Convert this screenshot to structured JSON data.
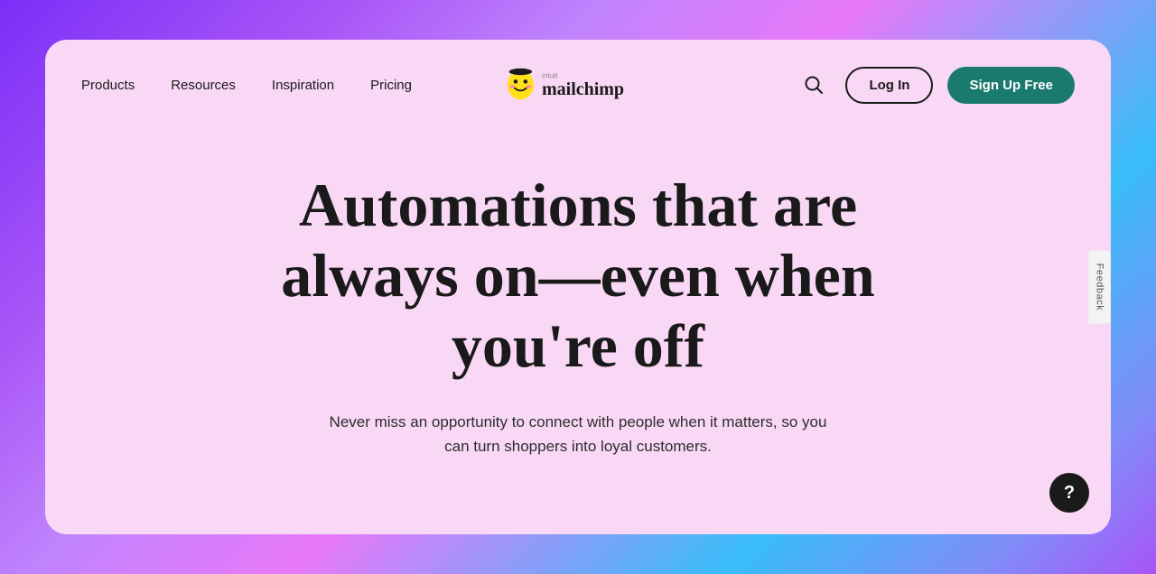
{
  "page": {
    "background": "gradient purple-pink-blue"
  },
  "navbar": {
    "nav_items": [
      {
        "label": "Products",
        "id": "products"
      },
      {
        "label": "Resources",
        "id": "resources"
      },
      {
        "label": "Inspiration",
        "id": "inspiration"
      },
      {
        "label": "Pricing",
        "id": "pricing"
      }
    ],
    "logo_alt": "Intuit Mailchimp",
    "login_label": "Log In",
    "signup_label": "Sign Up Free"
  },
  "hero": {
    "title": "Automations that are always on—even when you're off",
    "subtitle": "Never miss an opportunity to connect with people when it matters, so you can turn shoppers into loyal customers."
  },
  "feedback": {
    "label": "Feedback"
  },
  "help": {
    "label": "?"
  }
}
